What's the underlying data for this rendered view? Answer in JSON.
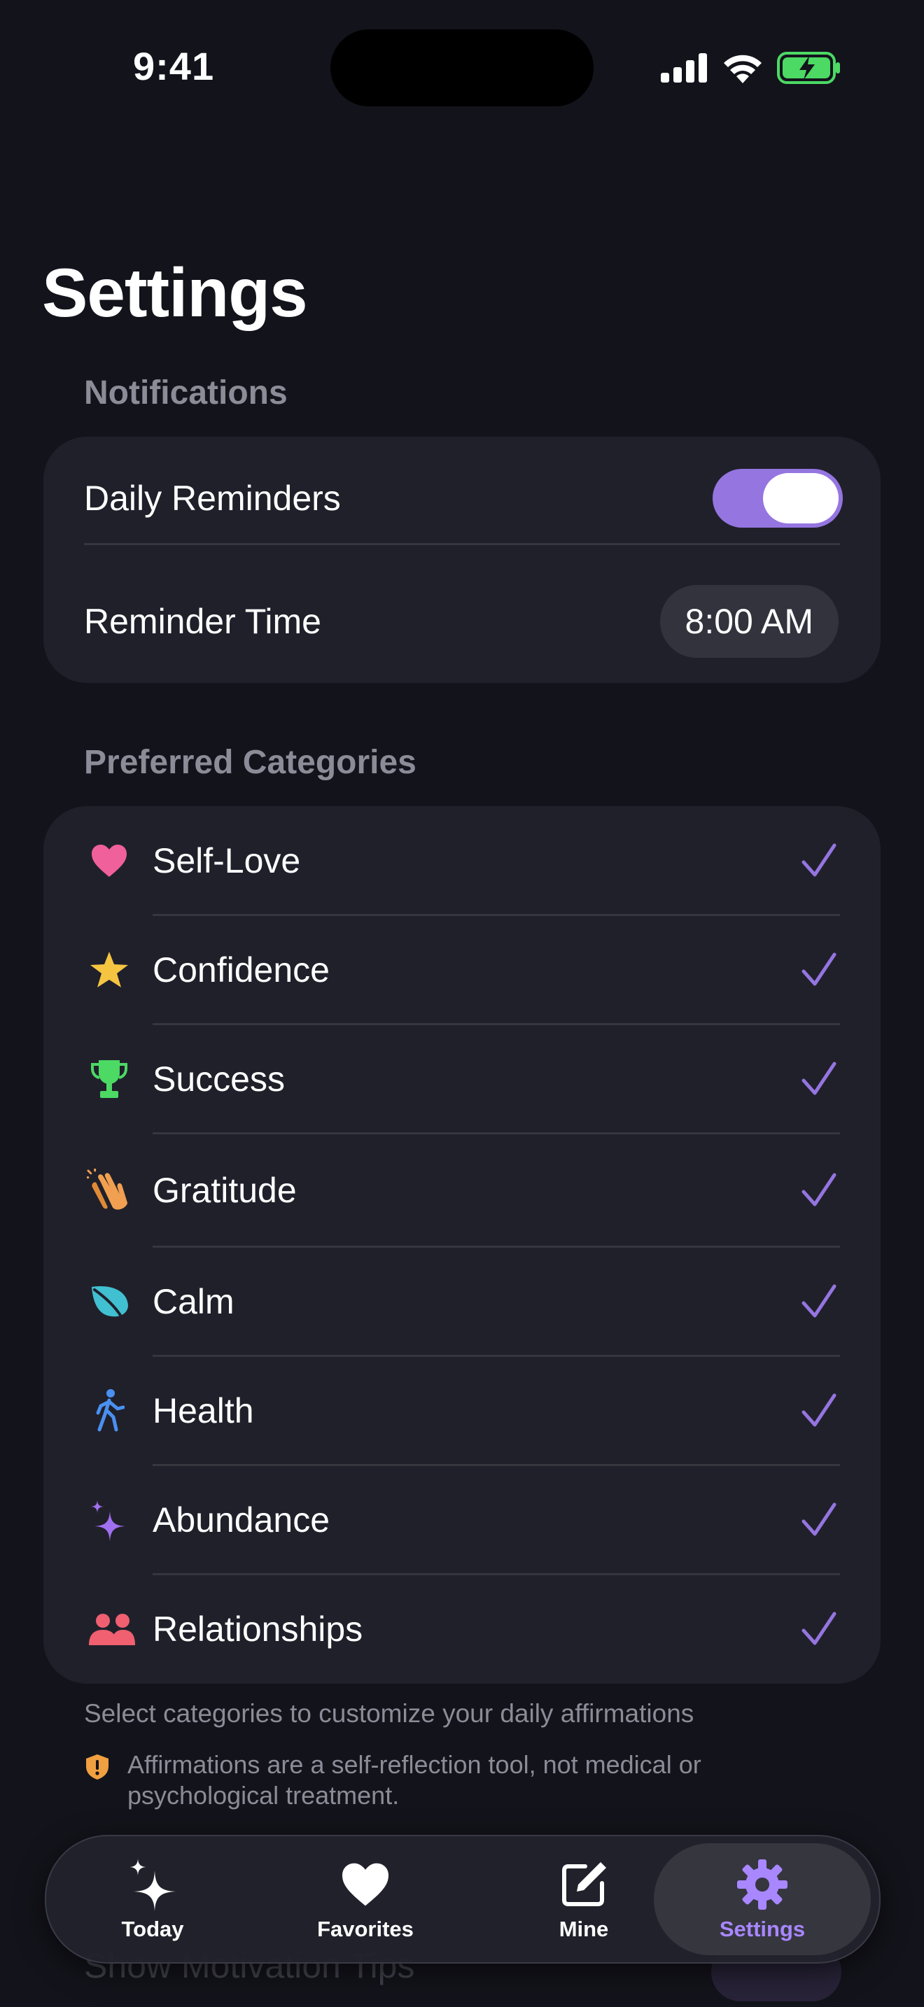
{
  "status_bar": {
    "time": "9:41"
  },
  "page": {
    "title": "Settings"
  },
  "notifications": {
    "header": "Notifications",
    "daily_reminders_label": "Daily Reminders",
    "daily_reminders_on": true,
    "reminder_time_label": "Reminder Time",
    "reminder_time_value": "8:00 AM"
  },
  "categories": {
    "header": "Preferred Categories",
    "items": [
      {
        "label": "Self-Love",
        "icon": "heart-icon",
        "color": "#f0609a",
        "selected": true
      },
      {
        "label": "Confidence",
        "icon": "star-icon",
        "color": "#f5c542",
        "selected": true
      },
      {
        "label": "Success",
        "icon": "trophy-icon",
        "color": "#4cd964",
        "selected": true
      },
      {
        "label": "Gratitude",
        "icon": "clapping-hands-icon",
        "color": "#f0a050",
        "selected": true
      },
      {
        "label": "Calm",
        "icon": "leaf-icon",
        "color": "#40c0d0",
        "selected": true
      },
      {
        "label": "Health",
        "icon": "walking-figure-icon",
        "color": "#4a90f0",
        "selected": true
      },
      {
        "label": "Abundance",
        "icon": "sparkles-icon",
        "color": "#a070f0",
        "selected": true
      },
      {
        "label": "Relationships",
        "icon": "people-icon",
        "color": "#f06070",
        "selected": true
      }
    ],
    "footer": "Select categories to customize your daily affirmations"
  },
  "disclaimer": {
    "text_line1": "Affirmations are a self-reflection tool, not medical or",
    "text_line2": "psychological treatment."
  },
  "hidden_row_label": "Show Motivation Tips",
  "tab_bar": {
    "tabs": [
      {
        "label": "Today",
        "icon": "sparkles-icon"
      },
      {
        "label": "Favorites",
        "icon": "heart-icon"
      },
      {
        "label": "Mine",
        "icon": "compose-icon"
      },
      {
        "label": "Settings",
        "icon": "gear-icon"
      }
    ],
    "active": "Settings"
  },
  "colors": {
    "accent": "#9575e0",
    "active_tab": "#a887ff",
    "background": "#13131b",
    "card": "#20202b"
  }
}
